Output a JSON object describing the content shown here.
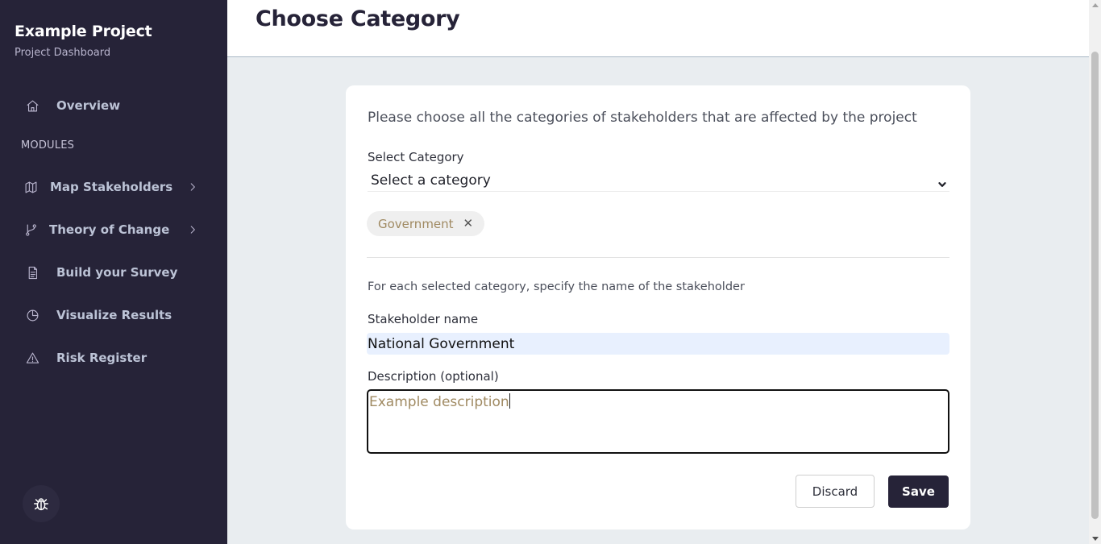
{
  "sidebar": {
    "project_name": "Example Project",
    "project_subtitle": "Project Dashboard",
    "overview_label": "Overview",
    "modules_heading": "MODULES",
    "items": [
      {
        "label": "Map Stakeholders",
        "icon": "map-icon",
        "has_submenu": true
      },
      {
        "label": "Theory of Change",
        "icon": "git-branch-icon",
        "has_submenu": true
      },
      {
        "label": "Build your Survey",
        "icon": "document-icon",
        "has_submenu": false
      },
      {
        "label": "Visualize Results",
        "icon": "pie-chart-icon",
        "has_submenu": false
      },
      {
        "label": "Risk Register",
        "icon": "warning-triangle-icon",
        "has_submenu": false
      }
    ],
    "debug_icon": "bug-icon"
  },
  "header": {
    "title": "Choose Category"
  },
  "form": {
    "intro_text": "Please choose all the categories of stakeholders that are affected by the project",
    "category_label": "Select Category",
    "category_selected": "Select a category",
    "chips": [
      {
        "label": "Government",
        "remove_glyph": "✕"
      }
    ],
    "hint_text": "For each selected category, specify the name of the stakeholder",
    "stakeholder_label": "Stakeholder name",
    "stakeholder_value": "National Government",
    "description_label": "Description (optional)",
    "description_placeholder": "Example description",
    "discard_label": "Discard",
    "save_label": "Save"
  },
  "colors": {
    "sidebar_bg": "#262338",
    "page_bg": "#e9edf0",
    "primary_button": "#262338",
    "chip_text": "#a08a62",
    "autofill_bg": "#e8f0fe"
  }
}
